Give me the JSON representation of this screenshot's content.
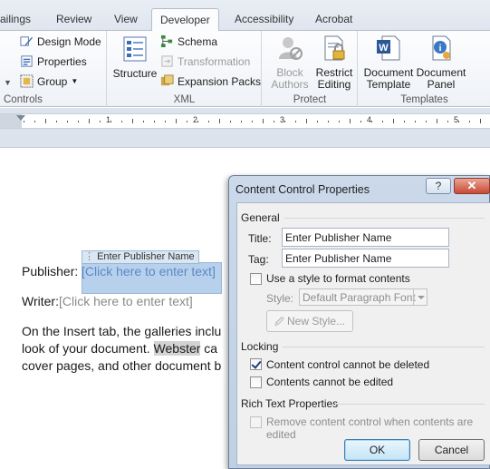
{
  "ribbon": {
    "tabs": [
      "ailings",
      "Review",
      "View",
      "Developer",
      "Accessibility",
      "Acrobat"
    ],
    "active_tab": "Developer",
    "controls": {
      "design_mode": "Design Mode",
      "properties": "Properties",
      "group": "Group",
      "label": "Controls"
    },
    "xml": {
      "structure": "Structure",
      "schema": "Schema",
      "transformation": "Transformation",
      "expansion_packs": "Expansion Packs",
      "label": "XML"
    },
    "protect": {
      "block_authors_1": "Block",
      "block_authors_2": "Authors",
      "restrict_editing_1": "Restrict",
      "restrict_editing_2": "Editing",
      "label": "Protect"
    },
    "templates": {
      "document_template_1": "Document",
      "document_template_2": "Template",
      "document_panel_1": "Document",
      "document_panel_2": "Panel",
      "label": "Templates"
    }
  },
  "ruler": {
    "numbers": [
      "1",
      "2",
      "3",
      "4",
      "5"
    ]
  },
  "document": {
    "publisher_label": "Publisher:",
    "publisher_control_title": "Enter Publisher Name",
    "publisher_placeholder": "[Click here to enter text]",
    "writer_label": "Writer:",
    "writer_placeholder": "[Click here to enter text]",
    "body_line1": "On the Insert tab, the galleries inclu",
    "body_line2_a": "look of your document. ",
    "body_line2_highlight": "Webster",
    "body_line2_b": " ca",
    "body_line3": "cover pages, and other document b"
  },
  "dialog": {
    "title": "Content Control Properties",
    "help_label": "?",
    "close_label": "✕",
    "general_label": "General",
    "title_label": "Title:",
    "title_value": "Enter Publisher Name",
    "tag_label": "Tag:",
    "tag_value": "Enter Publisher Name",
    "use_style_label": "Use a style to format contents",
    "use_style_checked": false,
    "style_label": "Style:",
    "style_value": "Default Paragraph Font",
    "new_style_label": "New Style...",
    "locking_label": "Locking",
    "cannot_delete_label": "Content control cannot be deleted",
    "cannot_delete_checked": true,
    "cannot_edit_label": "Contents cannot be edited",
    "cannot_edit_checked": false,
    "rich_text_label": "Rich Text Properties",
    "remove_label": "Remove content control when contents are edited",
    "remove_checked": false,
    "ok_label": "OK",
    "cancel_label": "Cancel"
  }
}
